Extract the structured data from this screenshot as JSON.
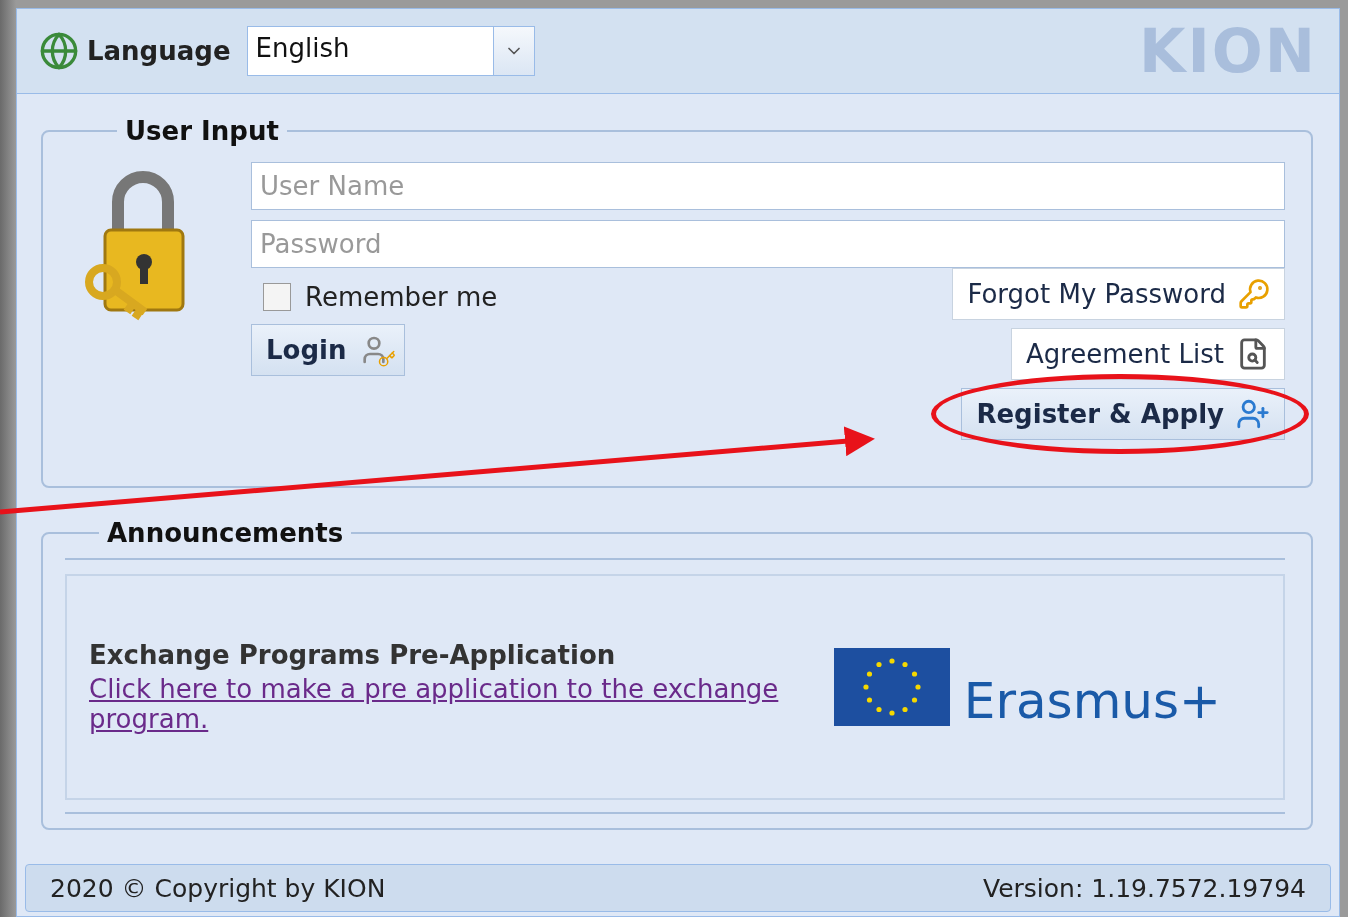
{
  "header": {
    "language_label": "Language",
    "language_value": "English",
    "logo_text": "KION"
  },
  "user_input": {
    "legend": "User Input",
    "username": {
      "placeholder": "User Name"
    },
    "password": {
      "placeholder": "Password"
    },
    "remember": {
      "label": "Remember me",
      "checked": false
    },
    "login": "Login",
    "buttons": [
      {
        "label": "Forgot My Password",
        "kind": "forgot",
        "circled": false
      },
      {
        "label": "Agreement List",
        "kind": "agreement",
        "circled": false
      },
      {
        "label": "Register & Apply",
        "kind": "register",
        "circled": true
      }
    ]
  },
  "announcements": {
    "legend": "Announcements",
    "title": "Exchange Programs Pre-Application",
    "link": "Click here to make a pre application to the exchange program.",
    "logo_text": "Erasmus+"
  },
  "footer": {
    "copyright": "2020 © Copyright by KION",
    "version": "Version: 1.19.7572.19794"
  }
}
